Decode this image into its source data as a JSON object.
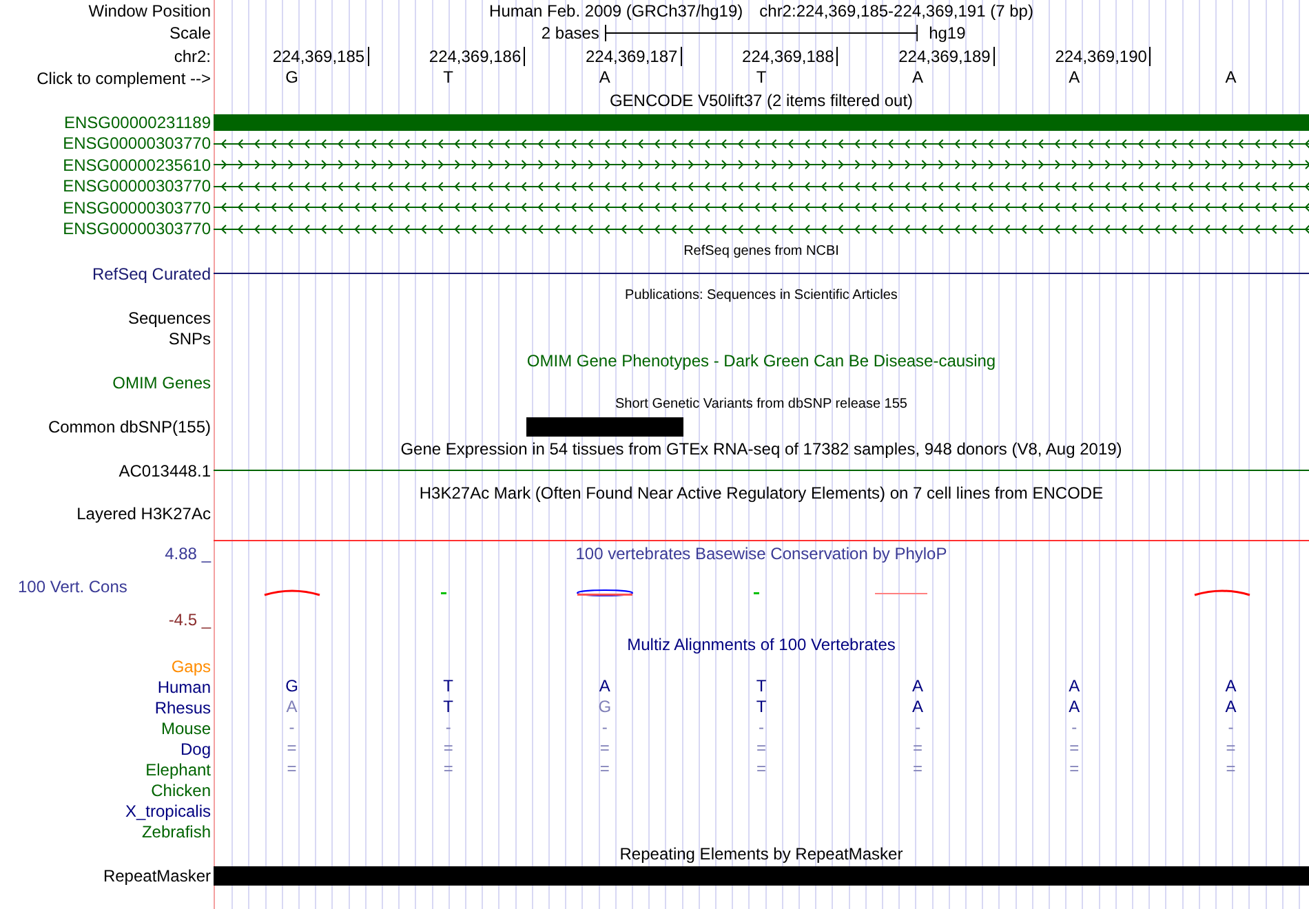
{
  "header": {
    "window_position": {
      "label": "Window Position",
      "assembly": "Human Feb. 2009 (GRCh37/hg19)",
      "position": "chr2:224,369,185-224,369,191 (7 bp)"
    },
    "scale": {
      "label": "Scale",
      "bar_label": "2 bases",
      "genome": "hg19"
    },
    "ruler": {
      "label": "chr2:",
      "positions": [
        "224,369,185",
        "224,369,186",
        "224,369,187",
        "224,369,188",
        "224,369,189",
        "224,369,190"
      ]
    },
    "complement": {
      "label": "Click to complement -->",
      "bases": [
        "G",
        "T",
        "A",
        "T",
        "A",
        "A",
        "A"
      ]
    }
  },
  "tracks": [
    {
      "kind": "title",
      "text": "GENCODE V50lift37 (2 items filtered out)",
      "color": "#000000"
    },
    {
      "kind": "gene",
      "label": "ENSG00000231189",
      "color": "#006400",
      "exon": true
    },
    {
      "kind": "gene",
      "label": "ENSG00000303770",
      "color": "#006400",
      "exon": false,
      "reverse": true
    },
    {
      "kind": "gene",
      "label": "ENSG00000235610",
      "color": "#006400",
      "exon": false,
      "reverse": false
    },
    {
      "kind": "gene",
      "label": "ENSG00000303770",
      "color": "#006400",
      "exon": false,
      "reverse": true
    },
    {
      "kind": "gene",
      "label": "ENSG00000303770",
      "color": "#006400",
      "exon": false,
      "reverse": true
    },
    {
      "kind": "gene",
      "label": "ENSG00000303770",
      "color": "#006400",
      "exon": false,
      "reverse": true
    },
    {
      "kind": "caption",
      "text": "RefSeq genes from NCBI"
    },
    {
      "kind": "line",
      "label": "RefSeq Curated",
      "color": "#191970",
      "rule": {
        "color": "#191970"
      }
    },
    {
      "kind": "caption",
      "text": "Publications: Sequences in Scientific Articles"
    },
    {
      "kind": "label",
      "label": "Sequences",
      "color": "#000000"
    },
    {
      "kind": "label",
      "label": "SNPs",
      "color": "#000000"
    },
    {
      "kind": "title",
      "text": "OMIM Gene Phenotypes - Dark Green Can Be Disease-causing",
      "color": "#006400"
    },
    {
      "kind": "label",
      "label": "OMIM Genes",
      "color": "#006400"
    },
    {
      "kind": "caption",
      "text": "Short Genetic Variants from dbSNP release 155"
    },
    {
      "kind": "bar",
      "label": "Common dbSNP(155)",
      "color": "#000000",
      "covered": [
        false,
        false,
        true,
        false,
        false,
        false,
        false
      ]
    },
    {
      "kind": "title",
      "text": "Gene Expression in 54 tissues from GTEx RNA-seq of 17382 samples, 948 donors (V8, Aug 2019)",
      "color": "#000000"
    },
    {
      "kind": "line",
      "label": "AC013448.1",
      "color": "#000000",
      "rule": {
        "color": "#006400"
      }
    },
    {
      "kind": "title",
      "text": "H3K27Ac Mark (Often Found Near Active Regulatory Elements) on 7 cell lines from ENCODE",
      "color": "#000000"
    },
    {
      "kind": "band",
      "label": "Layered H3K27Ac",
      "color": "#000000",
      "rule": {
        "color": "#ff3030"
      }
    },
    {
      "kind": "wiggle",
      "title": "100 vertebrates Basewise Conservation by PhyloP",
      "label": "100 Vert. Cons",
      "max_label": "4.88 _",
      "min_label": "-4.5 _",
      "color": "#3a3a96"
    },
    {
      "kind": "title",
      "text": "Multiz Alignments of 100 Vertebrates",
      "color": "#000080"
    },
    {
      "kind": "label",
      "label": "Gaps",
      "color": "#ff8c00"
    },
    {
      "kind": "species",
      "label": "Human",
      "color": "#000080",
      "bases": [
        {
          "text": "G",
          "differs": false
        },
        {
          "text": "T",
          "differs": false
        },
        {
          "text": "A",
          "differs": false
        },
        {
          "text": "T",
          "differs": false
        },
        {
          "text": "A",
          "differs": false
        },
        {
          "text": "A",
          "differs": false
        },
        {
          "text": "A",
          "differs": false
        }
      ]
    },
    {
      "kind": "species",
      "label": "Rhesus",
      "color": "#000080",
      "bases": [
        {
          "text": "A",
          "differs": true
        },
        {
          "text": "T",
          "differs": false
        },
        {
          "text": "G",
          "differs": true
        },
        {
          "text": "T",
          "differs": false
        },
        {
          "text": "A",
          "differs": false
        },
        {
          "text": "A",
          "differs": false
        },
        {
          "text": "A",
          "differs": false
        }
      ]
    },
    {
      "kind": "species",
      "label": "Mouse",
      "color": "#006400",
      "bases": [
        {
          "text": "-",
          "differs": true
        },
        {
          "text": "-",
          "differs": true
        },
        {
          "text": "-",
          "differs": true
        },
        {
          "text": "-",
          "differs": true
        },
        {
          "text": "-",
          "differs": true
        },
        {
          "text": "-",
          "differs": true
        },
        {
          "text": "-",
          "differs": true
        }
      ]
    },
    {
      "kind": "species",
      "label": "Dog",
      "color": "#000080",
      "bases": [
        {
          "text": "=",
          "differs": true
        },
        {
          "text": "=",
          "differs": true
        },
        {
          "text": "=",
          "differs": true
        },
        {
          "text": "=",
          "differs": true
        },
        {
          "text": "=",
          "differs": true
        },
        {
          "text": "=",
          "differs": true
        },
        {
          "text": "=",
          "differs": true
        }
      ]
    },
    {
      "kind": "species",
      "label": "Elephant",
      "color": "#006400",
      "bases": [
        {
          "text": "=",
          "differs": true
        },
        {
          "text": "=",
          "differs": true
        },
        {
          "text": "=",
          "differs": true
        },
        {
          "text": "=",
          "differs": true
        },
        {
          "text": "=",
          "differs": true
        },
        {
          "text": "=",
          "differs": true
        },
        {
          "text": "=",
          "differs": true
        }
      ]
    },
    {
      "kind": "species",
      "label": "Chicken",
      "color": "#006400"
    },
    {
      "kind": "species",
      "label": "X_tropicalis",
      "color": "#000080"
    },
    {
      "kind": "species",
      "label": "Zebrafish",
      "color": "#006400"
    },
    {
      "kind": "title",
      "text": "Repeating Elements by RepeatMasker",
      "color": "#000000"
    },
    {
      "kind": "bar",
      "label": "RepeatMasker",
      "color": "#000000",
      "covered": [
        true,
        true,
        true,
        true,
        true,
        true,
        true
      ]
    }
  ]
}
